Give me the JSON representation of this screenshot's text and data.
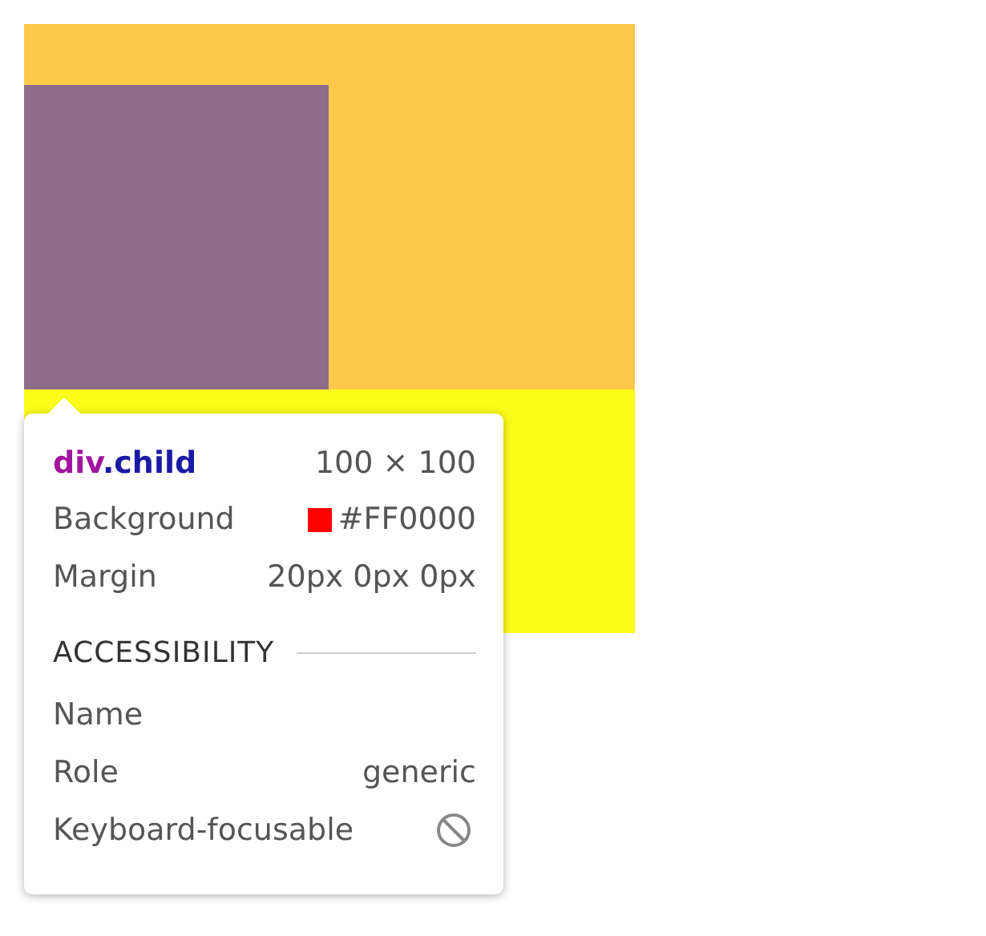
{
  "tooltip": {
    "tag": "div",
    "class_name": ".child",
    "size": "100 × 100",
    "properties": [
      {
        "kind": "swatch",
        "label": "Background",
        "value": "#FF0000"
      },
      {
        "kind": "text",
        "label": "Margin",
        "value": "20px 0px 0px"
      }
    ],
    "section": "ACCESSIBILITY",
    "accessibility": [
      {
        "kind": "text",
        "label": "Name"
      },
      {
        "kind": "text",
        "label": "Role",
        "value": "generic"
      },
      {
        "kind": "flag",
        "label": "Keyboard-focusable",
        "on": false
      }
    ]
  }
}
